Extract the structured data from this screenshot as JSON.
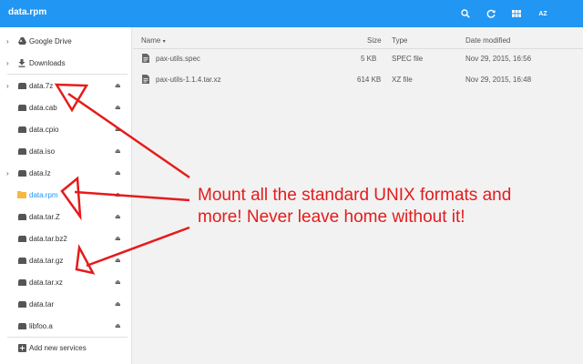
{
  "titlebar": {
    "title": "data.rpm",
    "buttons": [
      {
        "name": "search-button",
        "icon": "search-icon",
        "glyph": "🔍"
      },
      {
        "name": "refresh-button",
        "icon": "refresh-icon",
        "glyph": "↻"
      },
      {
        "name": "grid-view-button",
        "icon": "grid-icon",
        "glyph": "▦"
      },
      {
        "name": "sort-button",
        "icon": "sort-az-icon",
        "glyph": "AZ"
      }
    ]
  },
  "sidebar": {
    "items": [
      {
        "label": "Google Drive",
        "icon": "drive-icon",
        "chevron": true,
        "eject": false
      },
      {
        "label": "Downloads",
        "icon": "download-icon",
        "chevron": true,
        "eject": false
      },
      {
        "label": "data.7z",
        "icon": "archive-icon",
        "chevron": true,
        "eject": true
      },
      {
        "label": "data.cab",
        "icon": "archive-icon",
        "chevron": false,
        "eject": true
      },
      {
        "label": "data.cpio",
        "icon": "archive-icon",
        "chevron": false,
        "eject": true
      },
      {
        "label": "data.iso",
        "icon": "archive-icon",
        "chevron": false,
        "eject": true
      },
      {
        "label": "data.lz",
        "icon": "archive-icon",
        "chevron": true,
        "eject": true
      },
      {
        "label": "data.rpm",
        "icon": "folder-icon",
        "chevron": false,
        "eject": true,
        "selected": true
      },
      {
        "label": "data.tar.Z",
        "icon": "archive-icon",
        "chevron": false,
        "eject": true
      },
      {
        "label": "data.tar.bz2",
        "icon": "archive-icon",
        "chevron": false,
        "eject": true
      },
      {
        "label": "data.tar.gz",
        "icon": "archive-icon",
        "chevron": false,
        "eject": true
      },
      {
        "label": "data.tar.xz",
        "icon": "archive-icon",
        "chevron": false,
        "eject": true
      },
      {
        "label": "data.tar",
        "icon": "archive-icon",
        "chevron": false,
        "eject": true
      },
      {
        "label": "libfoo.a",
        "icon": "archive-icon",
        "chevron": false,
        "eject": true
      }
    ],
    "add_services": "Add new services"
  },
  "table": {
    "headers": {
      "name": "Name",
      "size": "Size",
      "type": "Type",
      "modified": "Date modified"
    },
    "rows": [
      {
        "name": "pax-utils.spec",
        "size": "5 KB",
        "type": "SPEC file",
        "modified": "Nov 29, 2015, 16:56"
      },
      {
        "name": "pax-utils-1.1.4.tar.xz",
        "size": "614 KB",
        "type": "XZ file",
        "modified": "Nov 29, 2015, 16:48"
      }
    ]
  },
  "annotation": {
    "line1": "Mount all the standard UNIX formats and",
    "line2": "more!  Never leave home without it!",
    "color": "#e51b1b"
  },
  "colors": {
    "accent": "#2196f3",
    "annotation": "#e51b1b"
  }
}
